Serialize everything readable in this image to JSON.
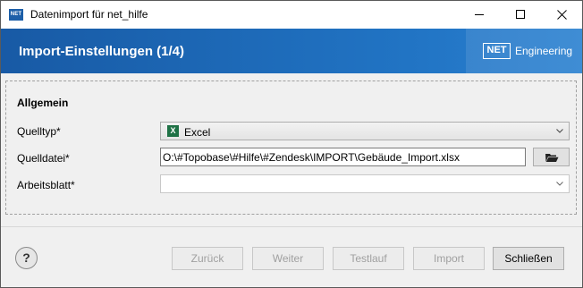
{
  "window": {
    "app_icon_text": "NET",
    "title": "Datenimport für net_hilfe"
  },
  "banner": {
    "title": "Import-Einstellungen (1/4)",
    "logo_net": "NET",
    "logo_text": "Engineering"
  },
  "section": {
    "title": "Allgemein",
    "fields": {
      "source_type": {
        "label": "Quelltyp*",
        "value": "Excel",
        "icon": "excel-icon"
      },
      "source_file": {
        "label": "Quelldatei*",
        "value": "O:\\#Topobase\\#Hilfe\\#Zendesk\\IMPORT\\Gebäude_Import.xlsx",
        "button_icon": "folder-open-icon"
      },
      "worksheet": {
        "label": "Arbeitsblatt*",
        "value": ""
      }
    }
  },
  "footer": {
    "help_label": "?",
    "buttons": {
      "back": "Zurück",
      "next": "Weiter",
      "test": "Testlauf",
      "import": "Import",
      "close": "Schließen"
    }
  }
}
